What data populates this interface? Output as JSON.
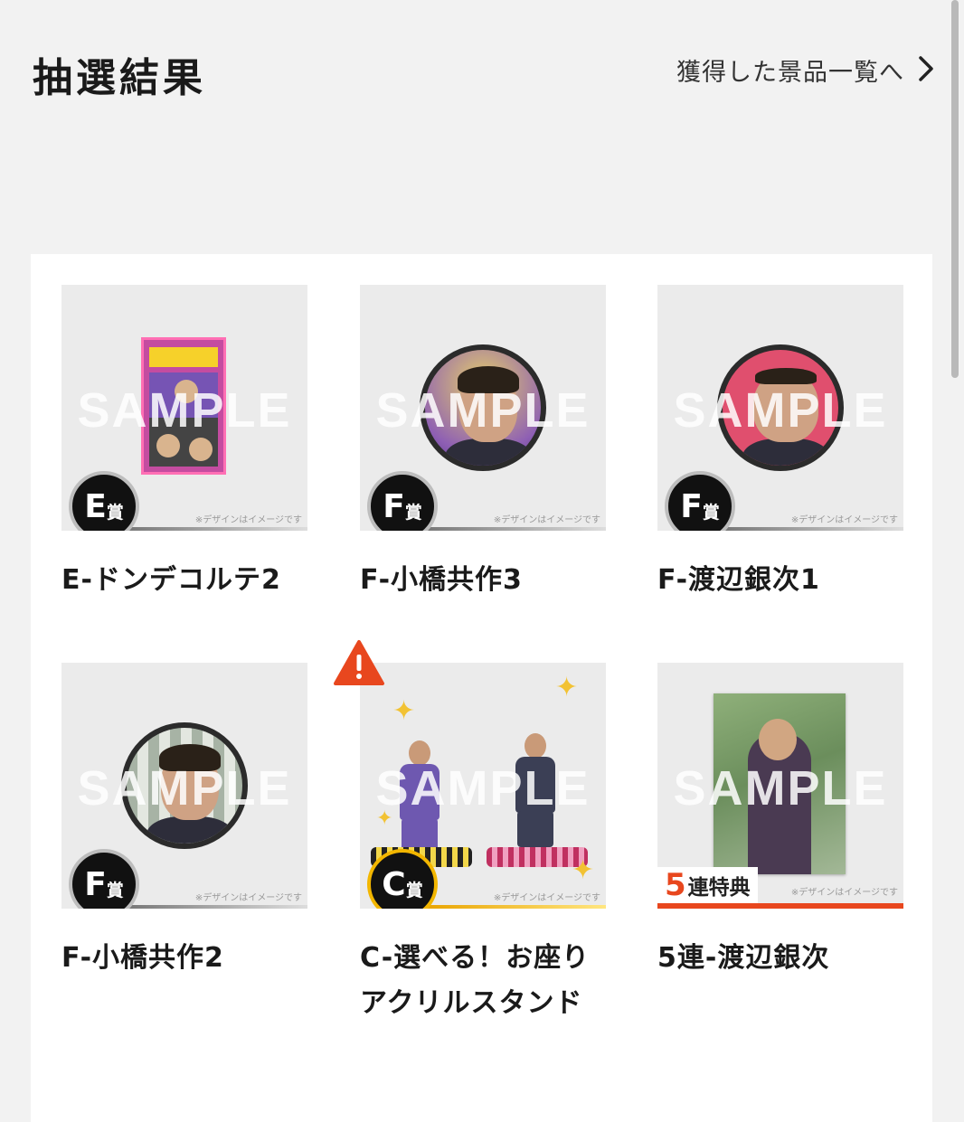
{
  "header": {
    "title": "抽選結果",
    "prize_list_link": "獲得した景品一覧へ"
  },
  "sample_watermark": "SAMPLE",
  "design_note": "※デザインはイメージです",
  "items": [
    {
      "title": "E-ドンデコルテ2",
      "rank_letter": "E",
      "rank_suffix": "賞"
    },
    {
      "title": "F-小橋共作3",
      "rank_letter": "F",
      "rank_suffix": "賞"
    },
    {
      "title": "F-渡辺銀次1",
      "rank_letter": "F",
      "rank_suffix": "賞"
    },
    {
      "title": "F-小橋共作2",
      "rank_letter": "F",
      "rank_suffix": "賞"
    },
    {
      "title": "C-選べる！お座りアクリルスタンド",
      "rank_letter": "C",
      "rank_suffix": "賞"
    },
    {
      "title": "5連-渡辺銀次",
      "bonus_number": "5",
      "bonus_text": "連特典"
    }
  ],
  "colors": {
    "background": "#f2f2f2",
    "panel": "#ffffff",
    "badge": "#111111",
    "gold": "#f2b600",
    "warning": "#e8471e",
    "bonus_accent": "#e8471e"
  },
  "icons": {
    "link_arrow": "chevron-right-icon",
    "warning": "warning-icon"
  }
}
